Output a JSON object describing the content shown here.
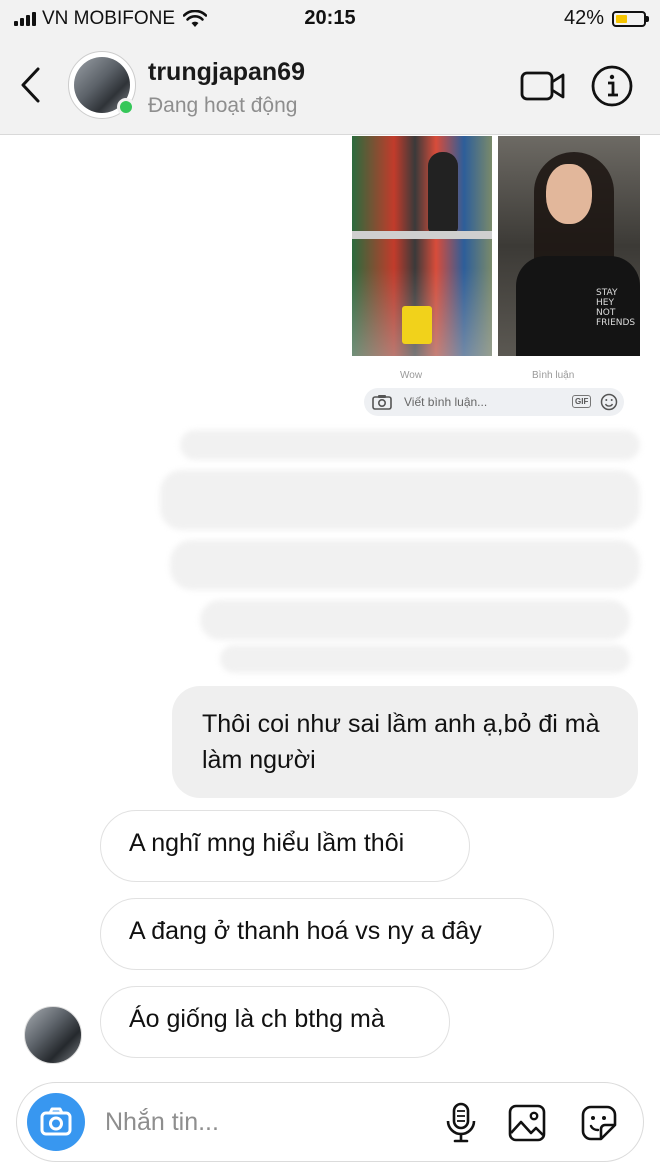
{
  "status_bar": {
    "carrier": "VN MOBIFONE",
    "time": "20:15",
    "battery_percent_label": "42%",
    "battery_level": 0.42,
    "battery_color": "#f5c400"
  },
  "header": {
    "username": "trungjapan69",
    "presence": "Đang hoạt động",
    "online_color": "#35c759",
    "icons": {
      "back": "chevron-left-icon",
      "video": "video-camera-icon",
      "info": "info-icon"
    }
  },
  "shared_post": {
    "comment_placeholder": "Viết bình luận...",
    "gif_label": "GIF",
    "reaction_label": "Wow",
    "comment_label": "Bình luận",
    "shirt_text": "STAY\nHEY\nNOT\nFRIENDS"
  },
  "messages": {
    "outgoing": [
      {
        "text": "Thôi coi như sai lầm anh ạ,bỏ đi mà làm người"
      }
    ],
    "incoming": [
      {
        "text": "A nghĩ mng hiểu lầm thôi"
      },
      {
        "text": "A đang ở thanh hoá vs ny a đây"
      },
      {
        "text": "Áo giống là ch bthg mà"
      }
    ]
  },
  "composer": {
    "placeholder": "Nhắn tin...",
    "accent_color": "#3897f0",
    "icons": {
      "camera": "camera-icon",
      "mic": "microphone-icon",
      "gallery": "gallery-icon",
      "sticker": "sticker-icon"
    }
  }
}
